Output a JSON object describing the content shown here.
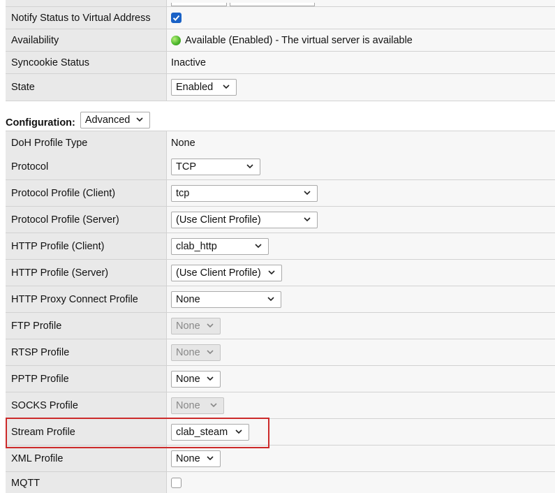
{
  "top": {
    "notify_label": "Notify Status to Virtual Address",
    "notify_checked": true,
    "availability_label": "Availability",
    "availability_value": "Available (Enabled) - The virtual server is available",
    "availability_color": "#4fb82e",
    "syncookie_label": "Syncookie Status",
    "syncookie_value": "Inactive",
    "state_label": "State",
    "state_value": "Enabled"
  },
  "configuration": {
    "label": "Configuration:",
    "mode": "Advanced"
  },
  "rows": {
    "doh_label": "DoH Profile Type",
    "doh_value": "None",
    "protocol_label": "Protocol",
    "protocol_value": "TCP",
    "proto_client_label": "Protocol Profile (Client)",
    "proto_client_value": "tcp",
    "proto_server_label": "Protocol Profile (Server)",
    "proto_server_value": "(Use Client Profile)",
    "http_client_label": "HTTP Profile (Client)",
    "http_client_value": "clab_http",
    "http_server_label": "HTTP Profile (Server)",
    "http_server_value": "(Use Client Profile)",
    "http_proxy_label": "HTTP Proxy Connect Profile",
    "http_proxy_value": "None",
    "ftp_label": "FTP Profile",
    "ftp_value": "None",
    "rtsp_label": "RTSP Profile",
    "rtsp_value": "None",
    "pptp_label": "PPTP Profile",
    "pptp_value": "None",
    "socks_label": "SOCKS Profile",
    "socks_value": "None",
    "stream_label": "Stream Profile",
    "stream_value": "clab_steam",
    "xml_label": "XML Profile",
    "xml_value": "None",
    "mqtt_label": "MQTT",
    "mqtt_checked": false
  },
  "highlight_color": "#cc2a2a"
}
